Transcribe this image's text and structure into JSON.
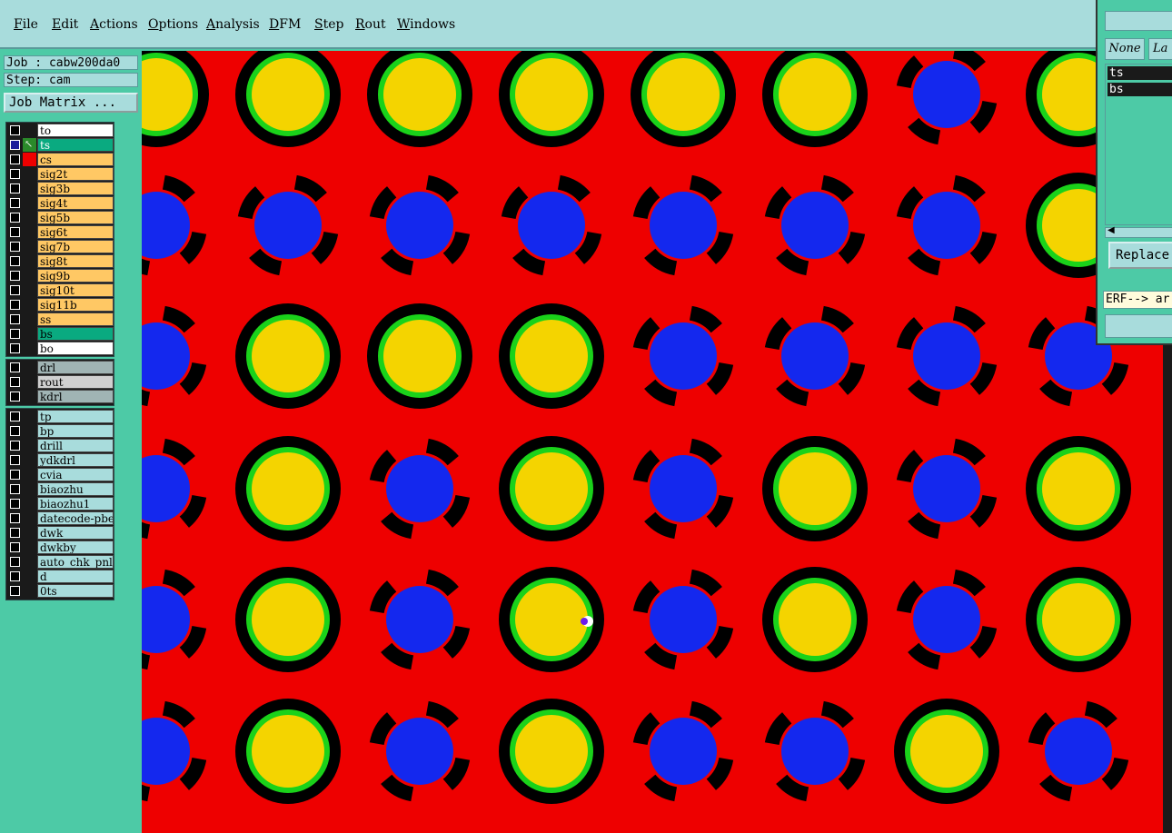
{
  "menu": [
    {
      "label": "File"
    },
    {
      "label": "Edit"
    },
    {
      "label": "Actions"
    },
    {
      "label": "Options"
    },
    {
      "label": "Analysis"
    },
    {
      "label": "DFM"
    },
    {
      "label": "Step"
    },
    {
      "label": "Rout"
    },
    {
      "label": "Windows"
    }
  ],
  "job": "Job : cabw200da0",
  "step": "Step: cam",
  "job_matrix_label": "Job Matrix ...",
  "layers_group1": [
    {
      "name": "to",
      "color": "#ffffff",
      "active": false
    },
    {
      "name": "ts",
      "color": "#0aaa80",
      "active": true
    },
    {
      "name": "cs",
      "color": "#ffc864",
      "active": false
    },
    {
      "name": "sig2t",
      "color": "#ffc864",
      "active": false
    },
    {
      "name": "sig3b",
      "color": "#ffc864",
      "active": false
    },
    {
      "name": "sig4t",
      "color": "#ffc864",
      "active": false
    },
    {
      "name": "sig5b",
      "color": "#ffc864",
      "active": false
    },
    {
      "name": "sig6t",
      "color": "#ffc864",
      "active": false
    },
    {
      "name": "sig7b",
      "color": "#ffc864",
      "active": false
    },
    {
      "name": "sig8t",
      "color": "#ffc864",
      "active": false
    },
    {
      "name": "sig9b",
      "color": "#ffc864",
      "active": false
    },
    {
      "name": "sig10t",
      "color": "#ffc864",
      "active": false
    },
    {
      "name": "sig11b",
      "color": "#ffc864",
      "active": false
    },
    {
      "name": "ss",
      "color": "#ffc864",
      "active": false
    },
    {
      "name": "bs",
      "color": "#0aaa80",
      "active": false
    },
    {
      "name": "bo",
      "color": "#ffffff",
      "active": false
    }
  ],
  "layers_group2": [
    {
      "name": "drl",
      "color": "#a0b4b4"
    },
    {
      "name": "rout",
      "color": "#d0d0d0"
    },
    {
      "name": "kdrl",
      "color": "#a0b4b4"
    }
  ],
  "layers_group3": [
    {
      "name": "tp"
    },
    {
      "name": "bp"
    },
    {
      "name": "drill"
    },
    {
      "name": "ydkdrl"
    },
    {
      "name": "cvia"
    },
    {
      "name": "biaozhu"
    },
    {
      "name": "biaozhu1"
    },
    {
      "name": "datecode-pbe"
    },
    {
      "name": "dwk"
    },
    {
      "name": "dwkby"
    },
    {
      "name": "auto_chk_pnl"
    },
    {
      "name": "d"
    },
    {
      "name": "0ts"
    }
  ],
  "right_panel": {
    "none_label": "None",
    "la_label": "La",
    "layers": [
      {
        "name": "ts"
      },
      {
        "name": "bs"
      }
    ],
    "replace_label": "Replace",
    "erf_text": "ERF--> ar"
  },
  "colors": {
    "background": "#ee0000",
    "pad_outer": "#000000",
    "pad_ring": "#1ad21a",
    "pad_fill": "#f4d400",
    "via_fill": "#1428ee"
  },
  "grid_pattern": [
    [
      "pad",
      "pad",
      "pad",
      "pad",
      "pad",
      "pad",
      "via",
      "pad"
    ],
    [
      "via",
      "via",
      "via",
      "via",
      "via",
      "via",
      "via",
      "pad"
    ],
    [
      "via",
      "pad",
      "pad",
      "pad",
      "via",
      "via",
      "via",
      "via"
    ],
    [
      "via",
      "pad",
      "via",
      "pad",
      "via",
      "pad",
      "via",
      "pad"
    ],
    [
      "via",
      "pad",
      "via",
      "pad",
      "via",
      "pad",
      "via",
      "pad"
    ],
    [
      "via",
      "pad",
      "via",
      "pad",
      "via",
      "via",
      "pad",
      "via"
    ]
  ]
}
